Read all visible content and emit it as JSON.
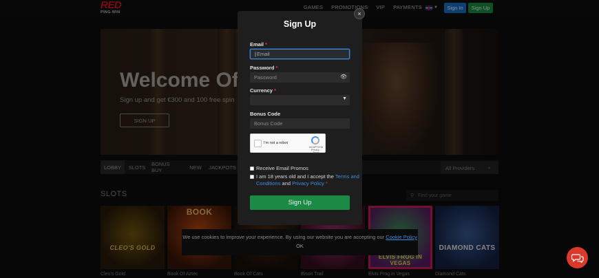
{
  "brand": {
    "logo_main": "RED",
    "logo_sub": "PING-WIN"
  },
  "nav": {
    "items": [
      "GAMES",
      "PROMOTIONS",
      "VIP",
      "PAYMENTS"
    ],
    "sign_in": "Sign In",
    "sign_up": "Sign Up",
    "language_icon": "uk-flag-icon"
  },
  "hero": {
    "title": "Welcome Off",
    "subtitle": "Sign up and get €300 and 100 free spin",
    "button": "SIGN UP"
  },
  "tabs": [
    "LOBBY",
    "SLOTS",
    "BONUS BUY",
    "NEW",
    "JACKPOTS"
  ],
  "providers": {
    "label": "All Providers"
  },
  "section": {
    "title": "SLOTS",
    "search_placeholder": "Find your game"
  },
  "games": [
    {
      "name": "Cleo's Gold",
      "logo": "CLEO'S GOLD"
    },
    {
      "name": "Book Of Aztec",
      "logo": "BOOK"
    },
    {
      "name": "Book Of Cats",
      "logo": "BOOK of CATS"
    },
    {
      "name": "Bison Trail",
      "logo": ""
    },
    {
      "name": "Elvis Frog in Vegas",
      "logo": "ELVIS FROG IN VEGAS"
    },
    {
      "name": "Diamond Cats",
      "logo": "DIAMOND CATS"
    }
  ],
  "modal": {
    "title": "Sign Up",
    "close": "×",
    "email": {
      "label": "Email",
      "placeholder": "Email"
    },
    "password": {
      "label": "Password",
      "placeholder": "Password"
    },
    "currency": {
      "label": "Currency",
      "value": ""
    },
    "bonus": {
      "label": "Bonus Code",
      "placeholder": "Bonus Code"
    },
    "captcha": {
      "label": "I'm not a robot",
      "brand": "reCAPTCHA",
      "links": "Privacy - Terms"
    },
    "receive_emails": "Receive Email Promos",
    "terms": {
      "prefix": "I am 18 years old and I accept the",
      "terms_link": "Terms and Conditions",
      "and": "and",
      "privacy_link": "Privacy Policy"
    },
    "submit": "Sign Up",
    "required_mark": "*"
  },
  "cookie": {
    "text": "We use cookies to improve your experience. By using our website you are accepting our",
    "link": "Cookie Policy",
    "ok": "OK"
  },
  "colors": {
    "accent_green": "#1b8a45",
    "accent_blue": "#1976d2",
    "brand_red": "#e0141e",
    "chat_red": "#d93a2b"
  }
}
